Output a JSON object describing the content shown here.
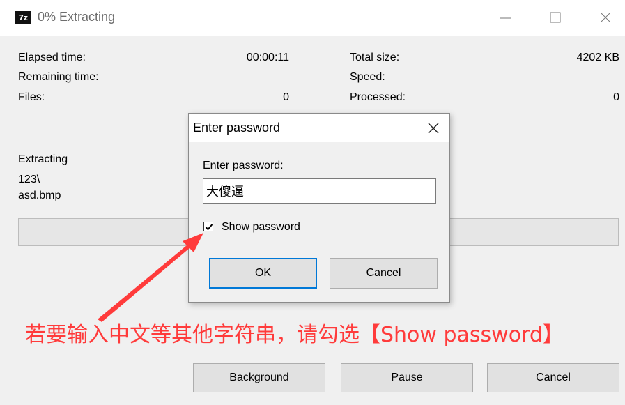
{
  "window": {
    "icon_text": "7z",
    "title": "0% Extracting"
  },
  "stats": {
    "elapsed_label": "Elapsed time:",
    "elapsed_value": "00:00:11",
    "remaining_label": "Remaining time:",
    "files_label": "Files:",
    "files_value": "0",
    "total_size_label": "Total size:",
    "total_size_value": "4202 KB",
    "speed_label": "Speed:",
    "processed_label": "Processed:",
    "processed_value": "0"
  },
  "current": {
    "status": "Extracting",
    "folder": "123\\",
    "file": "asd.bmp"
  },
  "progress": {
    "percent": 0
  },
  "buttons": {
    "background": "Background",
    "pause": "Pause",
    "cancel": "Cancel"
  },
  "dialog": {
    "title": "Enter password",
    "prompt": "Enter password:",
    "password_value": "大傻逼",
    "show_password_label": "Show password",
    "show_password_checked": true,
    "ok": "OK",
    "cancel": "Cancel"
  },
  "annotation": {
    "text": "若要输入中文等其他字符串，请勾选【Show password】",
    "color": "#ff3b3b"
  },
  "icons": [
    "minimize-icon",
    "maximize-icon",
    "close-icon",
    "dialog-close-icon",
    "checkmark-icon",
    "annotation-arrow"
  ]
}
